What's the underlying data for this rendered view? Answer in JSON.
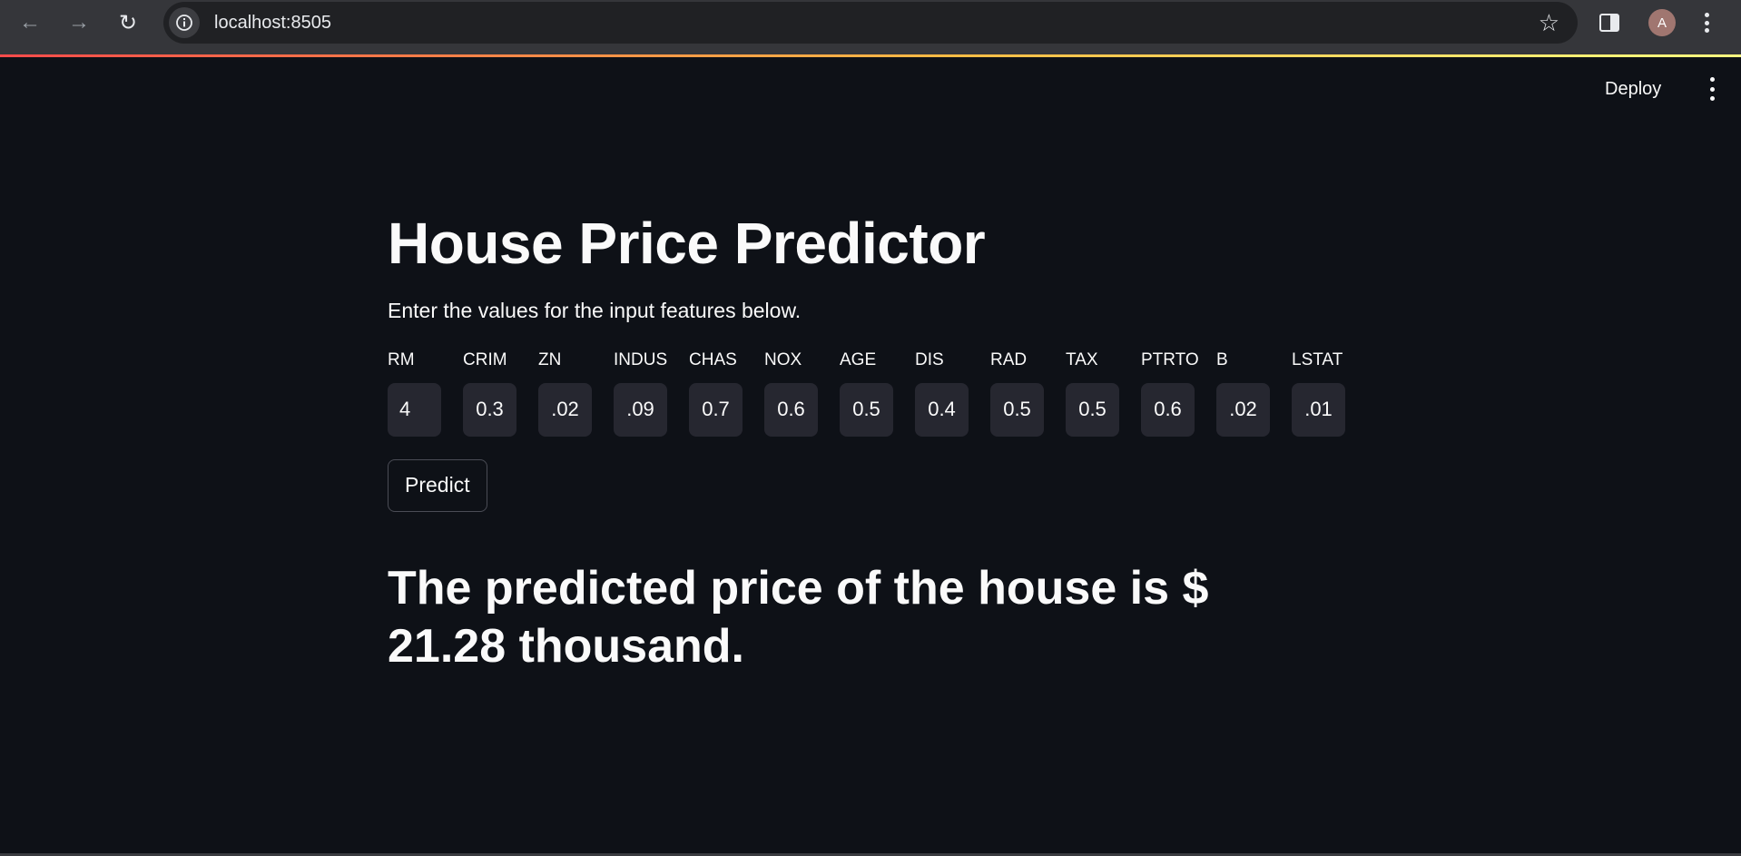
{
  "browser": {
    "url": "localhost:8505",
    "avatar_letter": "A"
  },
  "app_header": {
    "deploy_label": "Deploy"
  },
  "main": {
    "title": "House Price Predictor",
    "subtitle": "Enter the values for the input features below.",
    "fields": [
      {
        "label": "RM",
        "value": "4"
      },
      {
        "label": "CRIM",
        "value": "0.3"
      },
      {
        "label": "ZN",
        "value": ".02"
      },
      {
        "label": "INDUS",
        "value": ".09"
      },
      {
        "label": "CHAS",
        "value": "0.7"
      },
      {
        "label": "NOX",
        "value": "0.6"
      },
      {
        "label": "AGE",
        "value": "0.5"
      },
      {
        "label": "DIS",
        "value": "0.4"
      },
      {
        "label": "RAD",
        "value": "0.5"
      },
      {
        "label": "TAX",
        "value": "0.5"
      },
      {
        "label": "PTRTO",
        "value": "0.6"
      },
      {
        "label": "B",
        "value": ".02"
      },
      {
        "label": "LSTAT",
        "value": ".01"
      }
    ],
    "predict_label": "Predict",
    "result_text": "The predicted price of the house is $ 21.28 thousand."
  },
  "colors": {
    "background": "#0e1117",
    "input_background": "#262730",
    "text": "#fafafa",
    "accent_gradient_start": "#ff4b4b",
    "accent_gradient_end": "#fffd80"
  }
}
